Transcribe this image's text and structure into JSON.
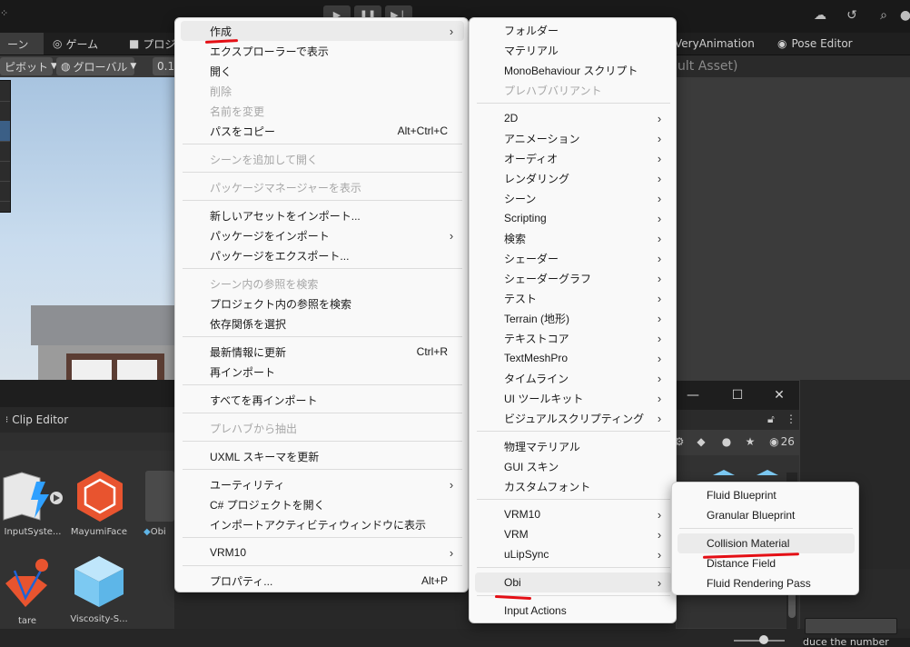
{
  "topbar": {
    "play_icons": [
      "play-icon",
      "pause-icon",
      "step-icon"
    ],
    "right_icons": [
      "cloud-icon",
      "history-icon",
      "search-icon",
      "account-icon"
    ]
  },
  "tabs": {
    "scene": "ーン",
    "game": "ゲーム",
    "project": "プロジェ",
    "very_animation": "VeryAnimation",
    "pose_editor": "Pose Editor"
  },
  "toolbar": {
    "pivot": "ピボット",
    "global": "グローバル",
    "snap": "0.1"
  },
  "inspector": {
    "title_fragment": "ult Asset)"
  },
  "clip_editor": {
    "title": "Clip Editor"
  },
  "assets": [
    {
      "label": "InputSyste...",
      "icon": "input-system-icon"
    },
    {
      "label": "MayumiFace",
      "icon": "hexagon-icon"
    },
    {
      "label": "Obi",
      "icon": "cube-icon"
    },
    {
      "label": "tare",
      "icon": "bone-icon"
    },
    {
      "label": "Viscosity-S...",
      "icon": "cube-icon"
    }
  ],
  "float_window": {
    "count": "26"
  },
  "status": {
    "hint": "duce the number"
  },
  "menu_main": {
    "items": [
      {
        "label": "作成",
        "shortcut": "",
        "submenu": true,
        "disabled": false,
        "hover": true
      },
      {
        "label": "エクスプローラーで表示",
        "shortcut": "",
        "submenu": false,
        "disabled": false
      },
      {
        "label": "開く",
        "shortcut": "",
        "submenu": false,
        "disabled": false
      },
      {
        "label": "削除",
        "shortcut": "",
        "submenu": false,
        "disabled": true
      },
      {
        "label": "名前を変更",
        "shortcut": "",
        "submenu": false,
        "disabled": true
      },
      {
        "label": "パスをコピー",
        "shortcut": "Alt+Ctrl+C",
        "submenu": false,
        "disabled": false
      },
      {
        "label": "シーンを追加して開く",
        "shortcut": "",
        "submenu": false,
        "disabled": true
      },
      {
        "label": "パッケージマネージャーを表示",
        "shortcut": "",
        "submenu": false,
        "disabled": true
      },
      {
        "label": "新しいアセットをインポート...",
        "shortcut": "",
        "submenu": false,
        "disabled": false
      },
      {
        "label": "パッケージをインポート",
        "shortcut": "",
        "submenu": true,
        "disabled": false
      },
      {
        "label": "パッケージをエクスポート...",
        "shortcut": "",
        "submenu": false,
        "disabled": false
      },
      {
        "label": "シーン内の参照を検索",
        "shortcut": "",
        "submenu": false,
        "disabled": true
      },
      {
        "label": "プロジェクト内の参照を検索",
        "shortcut": "",
        "submenu": false,
        "disabled": false
      },
      {
        "label": "依存関係を選択",
        "shortcut": "",
        "submenu": false,
        "disabled": false
      },
      {
        "label": "最新情報に更新",
        "shortcut": "Ctrl+R",
        "submenu": false,
        "disabled": false
      },
      {
        "label": "再インポート",
        "shortcut": "",
        "submenu": false,
        "disabled": false
      },
      {
        "label": "すべてを再インポート",
        "shortcut": "",
        "submenu": false,
        "disabled": false
      },
      {
        "label": "プレハブから抽出",
        "shortcut": "",
        "submenu": false,
        "disabled": true
      },
      {
        "label": "UXML スキーマを更新",
        "shortcut": "",
        "submenu": false,
        "disabled": false
      },
      {
        "label": "ユーティリティ",
        "shortcut": "",
        "submenu": true,
        "disabled": false
      },
      {
        "label": "C# プロジェクトを開く",
        "shortcut": "",
        "submenu": false,
        "disabled": false
      },
      {
        "label": "インポートアクティビティウィンドウに表示",
        "shortcut": "",
        "submenu": false,
        "disabled": false
      },
      {
        "label": "VRM10",
        "shortcut": "",
        "submenu": true,
        "disabled": false
      },
      {
        "label": "プロパティ...",
        "shortcut": "Alt+P",
        "submenu": false,
        "disabled": false
      }
    ]
  },
  "menu_create": {
    "items": [
      {
        "label": "フォルダー",
        "submenu": false,
        "disabled": false
      },
      {
        "label": "マテリアル",
        "submenu": false,
        "disabled": false
      },
      {
        "label": "MonoBehaviour スクリプト",
        "submenu": false,
        "disabled": false
      },
      {
        "label": "プレハブバリアント",
        "submenu": false,
        "disabled": true
      },
      {
        "label": "2D",
        "submenu": true,
        "disabled": false
      },
      {
        "label": "アニメーション",
        "submenu": true,
        "disabled": false
      },
      {
        "label": "オーディオ",
        "submenu": true,
        "disabled": false
      },
      {
        "label": "レンダリング",
        "submenu": true,
        "disabled": false
      },
      {
        "label": "シーン",
        "submenu": true,
        "disabled": false
      },
      {
        "label": "Scripting",
        "submenu": true,
        "disabled": false
      },
      {
        "label": "検索",
        "submenu": true,
        "disabled": false
      },
      {
        "label": "シェーダー",
        "submenu": true,
        "disabled": false
      },
      {
        "label": "シェーダーグラフ",
        "submenu": true,
        "disabled": false
      },
      {
        "label": "テスト",
        "submenu": true,
        "disabled": false
      },
      {
        "label": "Terrain (地形)",
        "submenu": true,
        "disabled": false
      },
      {
        "label": "テキストコア",
        "submenu": true,
        "disabled": false
      },
      {
        "label": "TextMeshPro",
        "submenu": true,
        "disabled": false
      },
      {
        "label": "タイムライン",
        "submenu": true,
        "disabled": false
      },
      {
        "label": "UI ツールキット",
        "submenu": true,
        "disabled": false
      },
      {
        "label": "ビジュアルスクリプティング",
        "submenu": true,
        "disabled": false
      },
      {
        "label": "物理マテリアル",
        "submenu": false,
        "disabled": false
      },
      {
        "label": "GUI スキン",
        "submenu": false,
        "disabled": false
      },
      {
        "label": "カスタムフォント",
        "submenu": false,
        "disabled": false
      },
      {
        "label": "VRM10",
        "submenu": true,
        "disabled": false
      },
      {
        "label": "VRM",
        "submenu": true,
        "disabled": false
      },
      {
        "label": "uLipSync",
        "submenu": true,
        "disabled": false
      },
      {
        "label": "Obi",
        "submenu": true,
        "disabled": false,
        "hover": true
      },
      {
        "label": "Input Actions",
        "submenu": false,
        "disabled": false
      }
    ]
  },
  "menu_obi": {
    "items": [
      {
        "label": "Fluid Blueprint"
      },
      {
        "label": "Granular Blueprint"
      },
      {
        "label": "Collision Material",
        "hover": true
      },
      {
        "label": "Distance Field"
      },
      {
        "label": "Fluid Rendering Pass"
      }
    ]
  },
  "colors": {
    "annotation_red": "#e40f15",
    "menu_bg": "#f9f9f9",
    "editor_bg": "#282828"
  }
}
